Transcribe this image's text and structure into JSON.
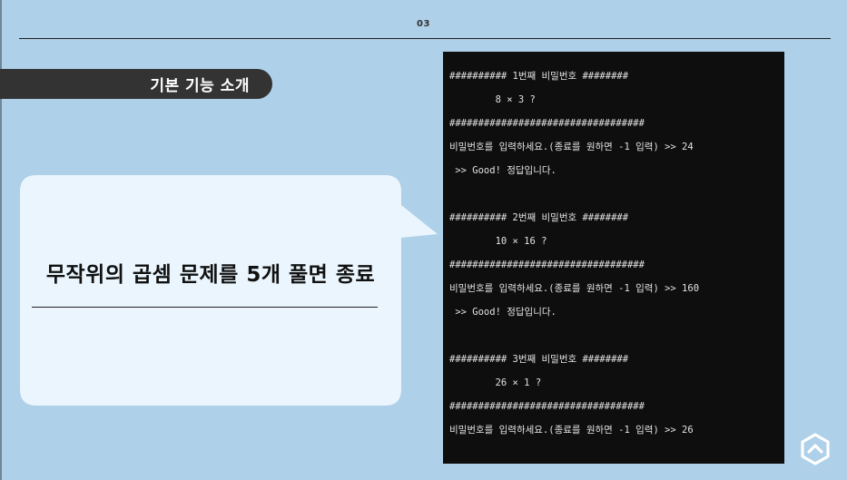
{
  "slide": {
    "page_number": "03",
    "section_label": "기본 기능 소개",
    "bubble_text": "무작위의 곱셈 문제를 5개 풀면 종료"
  },
  "terminal": {
    "lines": [
      "########## 1번째 비밀번호 ########",
      "        8 × 3 ?",
      "##################################",
      "비밀번호를 입력하세요.(종료를 원하면 -1 입력) >> 24",
      " >> Good! 정답입니다.",
      "",
      "########## 2번째 비밀번호 ########",
      "        10 × 16 ?",
      "##################################",
      "비밀번호를 입력하세요.(종료를 원하면 -1 입력) >> 160",
      " >> Good! 정답입니다.",
      "",
      "########## 3번째 비밀번호 ########",
      "        26 × 1 ?",
      "##################################",
      "비밀번호를 입력하세요.(종료를 원하면 -1 입력) >> 26"
    ]
  },
  "colors": {
    "background": "#aed0e8",
    "bubble": "#eaf5fd",
    "tab": "#333333",
    "terminal_bg": "#0e0e0e",
    "terminal_text": "#e2e2e2"
  },
  "icons": {
    "logo": "hexagon-chevron-logo-icon"
  }
}
